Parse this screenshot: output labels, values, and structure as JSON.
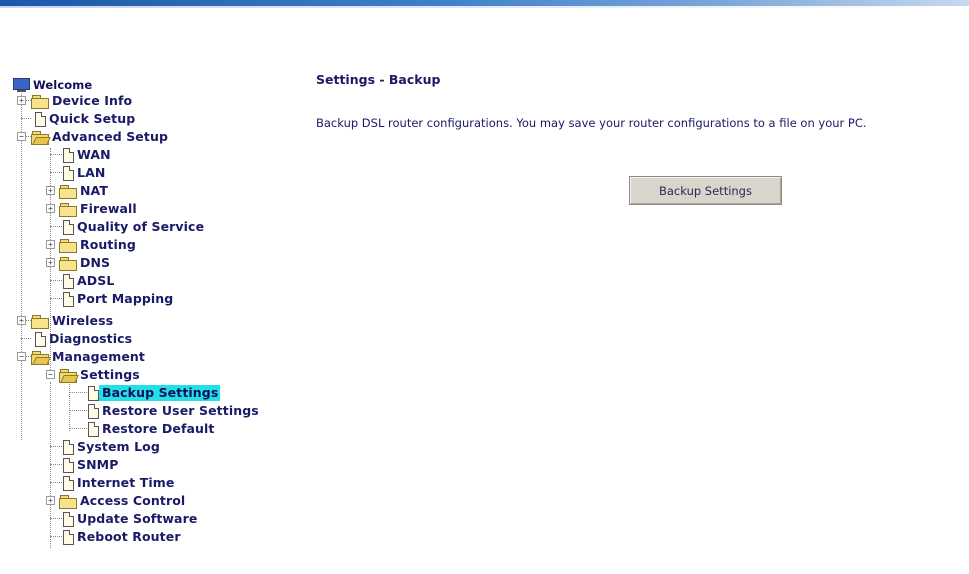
{
  "tree": {
    "welcome": "Welcome",
    "device_info": "Device Info",
    "quick_setup": "Quick Setup",
    "advanced_setup": "Advanced Setup",
    "wan": "WAN",
    "lan": "LAN",
    "nat": "NAT",
    "firewall": "Firewall",
    "qos": "Quality of Service",
    "routing": "Routing",
    "dns": "DNS",
    "adsl": "ADSL",
    "port_mapping": "Port Mapping",
    "wireless": "Wireless",
    "diagnostics": "Diagnostics",
    "management": "Management",
    "settings": "Settings",
    "backup_settings": "Backup Settings",
    "restore_user_settings": "Restore User Settings",
    "restore_default": "Restore Default",
    "system_log": "System Log",
    "snmp": "SNMP",
    "internet_time": "Internet Time",
    "access_control": "Access Control",
    "update_software": "Update Software",
    "reboot_router": "Reboot Router"
  },
  "content": {
    "title": "Settings - Backup",
    "description": "Backup DSL router configurations. You may save your router configurations to a file on your PC.",
    "button_label": "Backup Settings"
  },
  "colors": {
    "text": "#1a1a66",
    "selected_bg": "#22e0e6",
    "button_bg": "#d9d5cc"
  }
}
